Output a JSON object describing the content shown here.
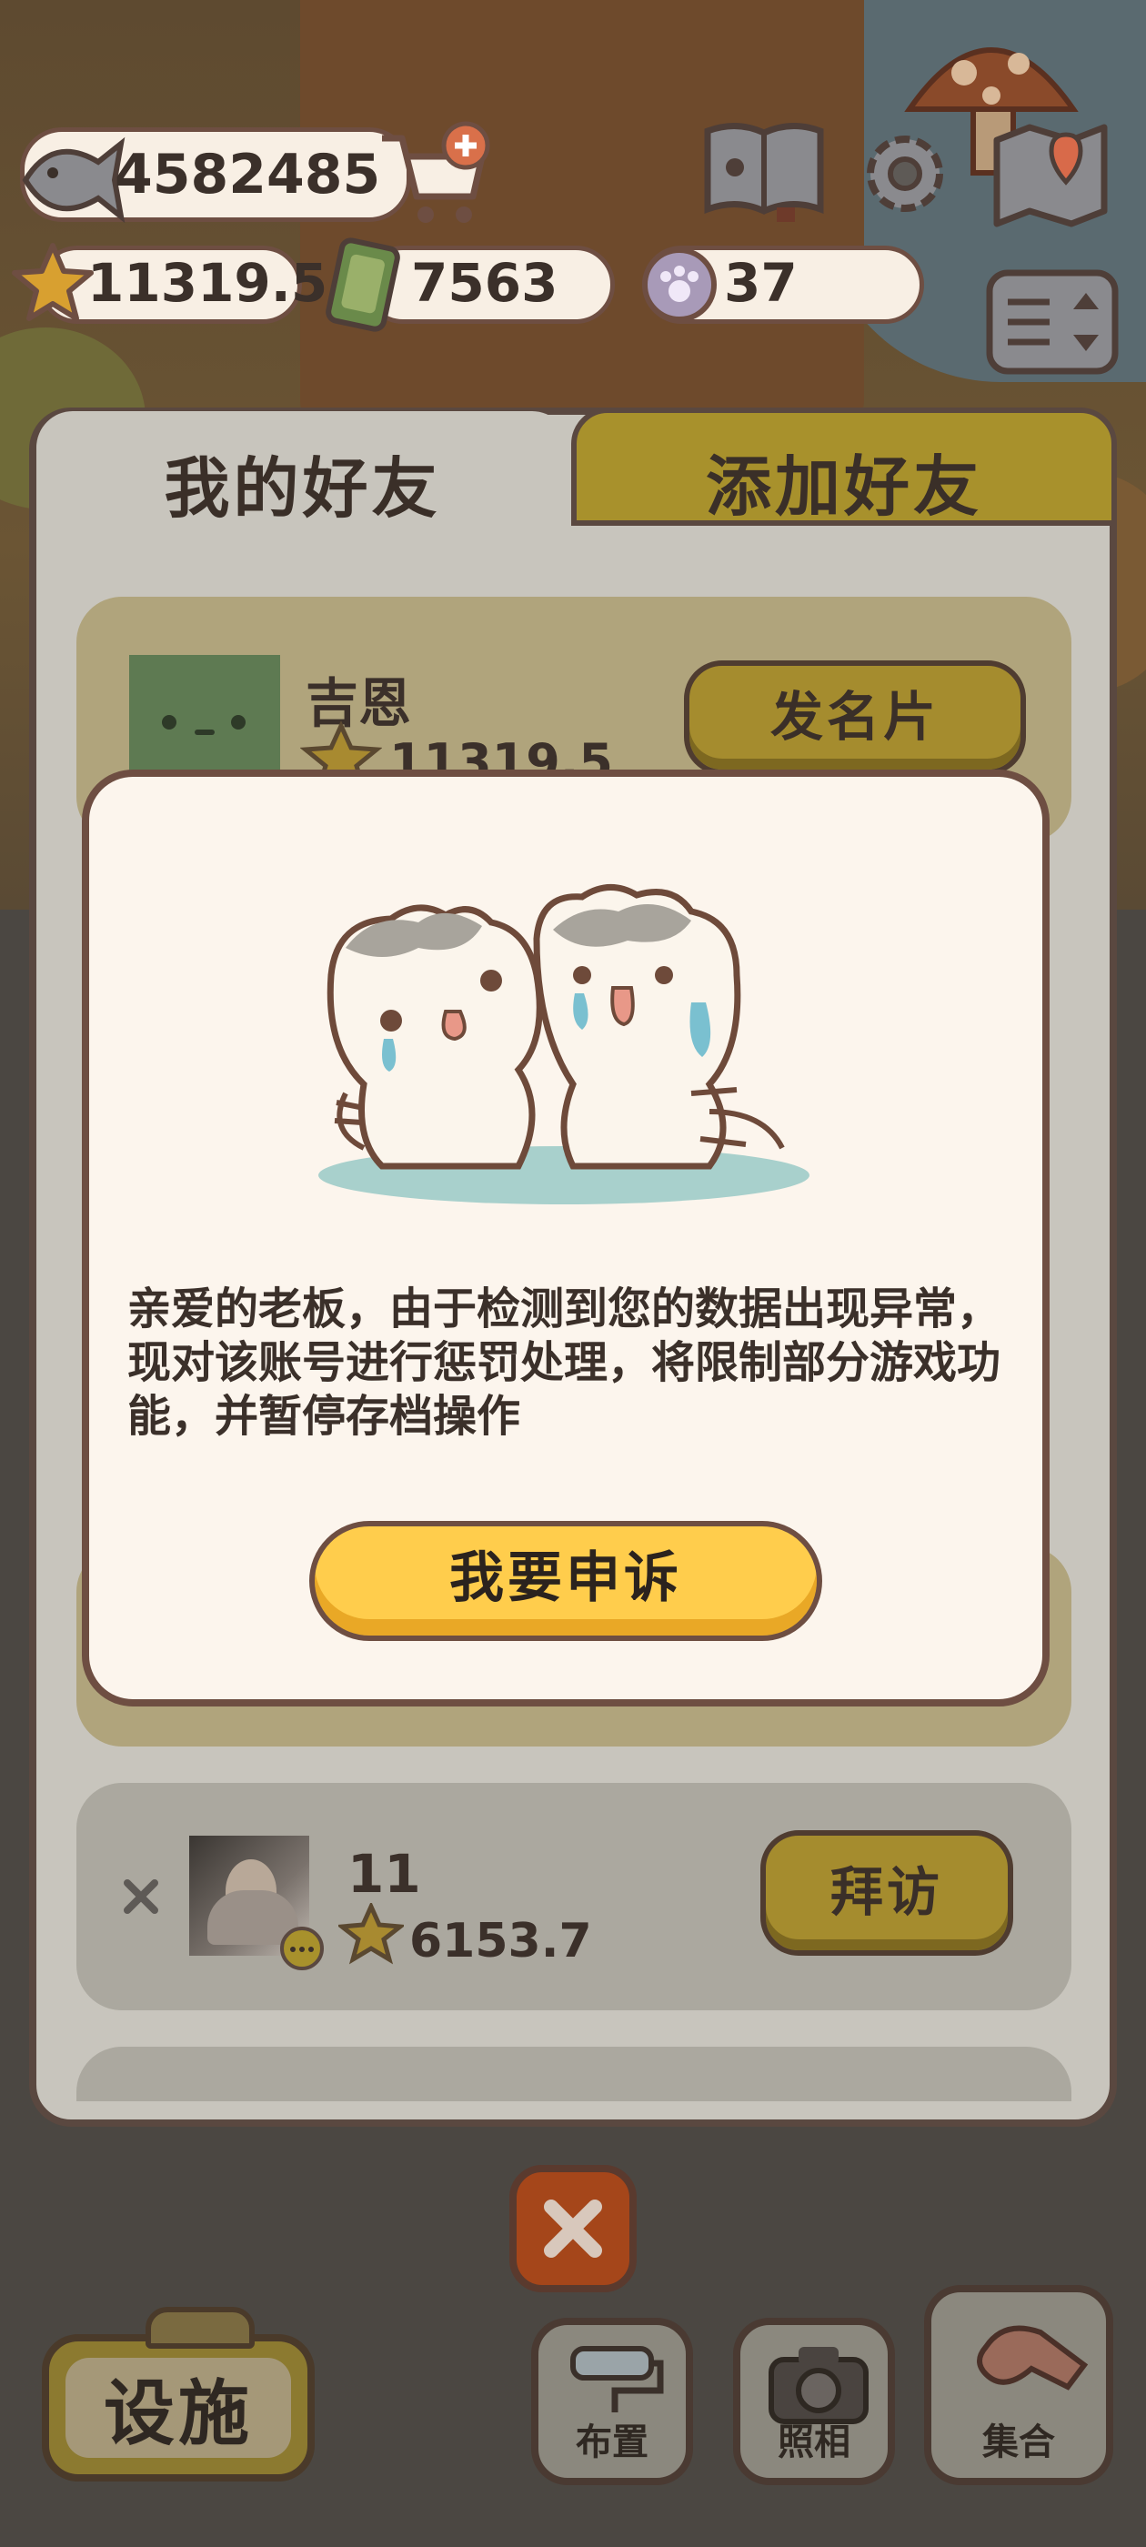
{
  "hud": {
    "fish_count": "4582485",
    "star_value": "11319.5",
    "ticket_count": "7563",
    "paw_coin_count": "37"
  },
  "tabs": {
    "my_friends": "我的好友",
    "add_friends": "添加好友"
  },
  "friends": [
    {
      "name": "吉恩",
      "score": "11319.5",
      "button": "发名片"
    },
    {
      "name": "11",
      "score": "6153.7",
      "button": "拜访"
    }
  ],
  "dialog": {
    "message": "亲爱的老板，由于检测到您的数据出现异常，现对该账号进行惩罚处理，将限制部分游戏功能，并暂停存档操作",
    "appeal_button": "我要申诉"
  },
  "bottom_bar": {
    "facility": "设施",
    "layout": "布置",
    "photo": "照相",
    "gather": "集合"
  },
  "colors": {
    "accent_yellow": "#ffcd4c",
    "dialog_bg": "#fcf5ed",
    "outline_brown": "#6e4e42"
  }
}
